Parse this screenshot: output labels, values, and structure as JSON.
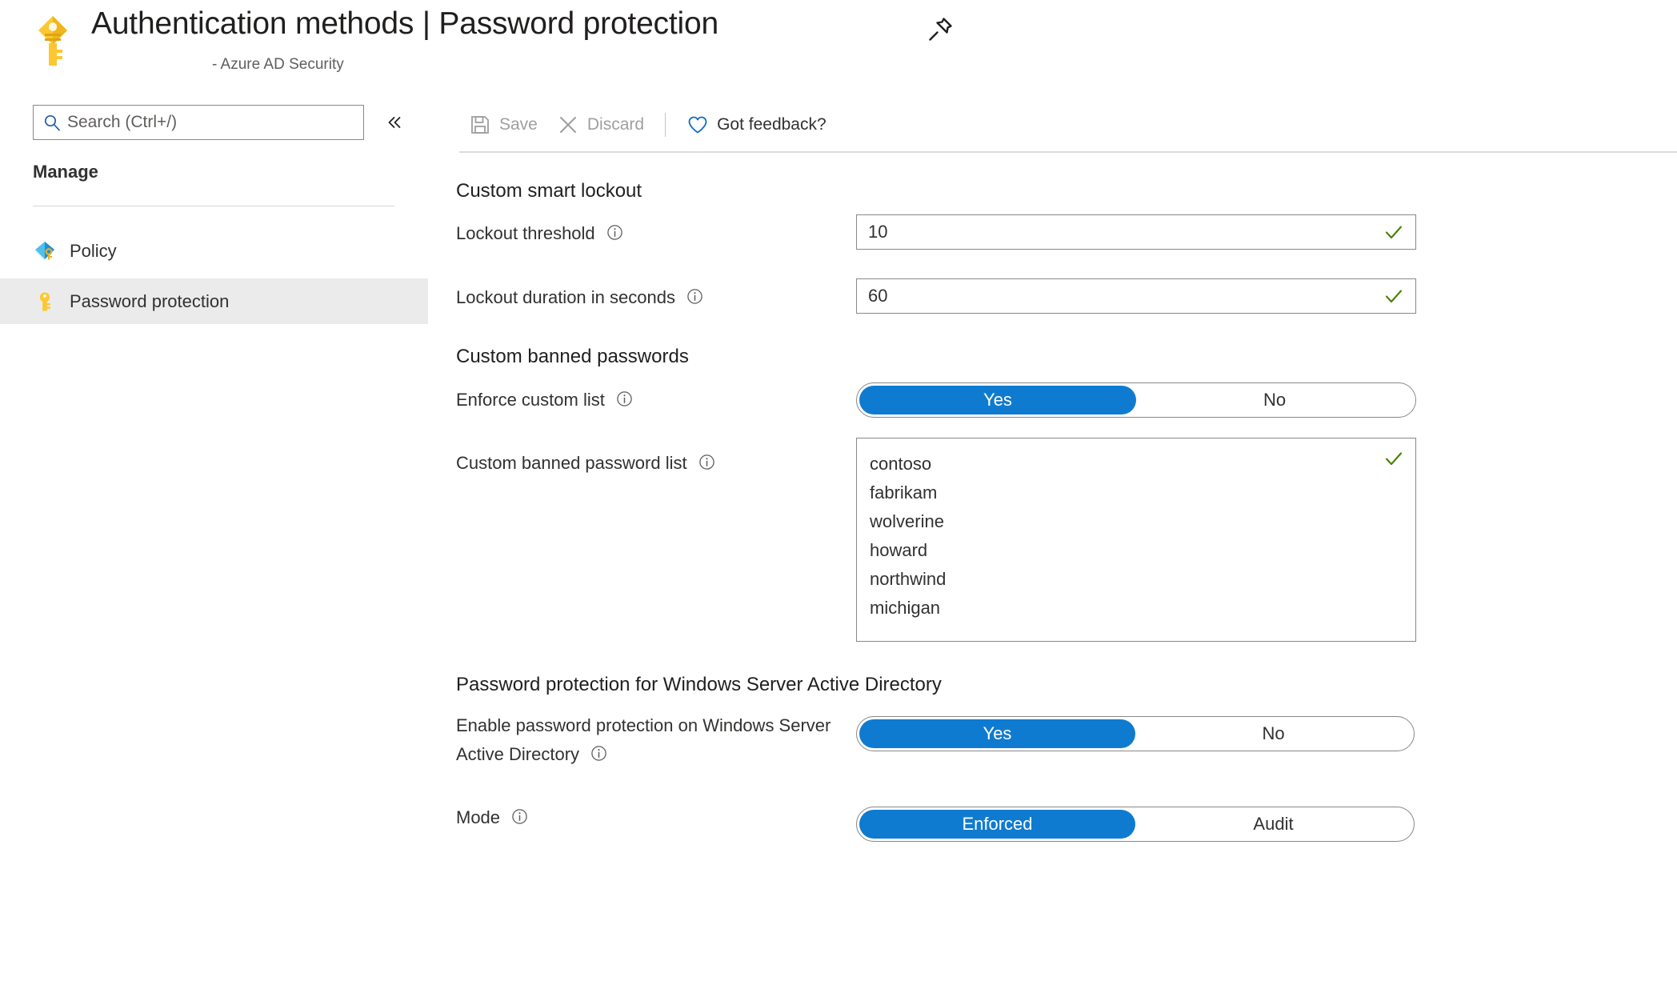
{
  "header": {
    "icon": "key-icon",
    "title": "Authentication methods | Password protection",
    "subtitle": "- Azure AD Security",
    "pin_icon": "pin-icon"
  },
  "sidebar": {
    "search": {
      "placeholder": "Search (Ctrl+/)",
      "value": "",
      "icon": "search-icon"
    },
    "collapse_icon": "chevron-double-left-icon",
    "group_label": "Manage",
    "items": [
      {
        "label": "Policy",
        "icon": "policy-shield-key-icon",
        "selected": false
      },
      {
        "label": "Password protection",
        "icon": "key-icon",
        "selected": true
      }
    ]
  },
  "toolbar": {
    "save_label": "Save",
    "save_icon": "save-floppy-icon",
    "save_disabled": true,
    "discard_label": "Discard",
    "discard_icon": "close-x-icon",
    "discard_disabled": true,
    "feedback_label": "Got feedback?",
    "feedback_icon": "heart-icon"
  },
  "main": {
    "smart_lockout": {
      "section_title": "Custom smart lockout",
      "threshold": {
        "label": "Lockout threshold",
        "info_icon": "info-icon",
        "value": "10",
        "valid_icon": "checkmark-icon"
      },
      "duration": {
        "label": "Lockout duration in seconds",
        "info_icon": "info-icon",
        "value": "60",
        "valid_icon": "checkmark-icon"
      }
    },
    "banned_passwords": {
      "section_title": "Custom banned passwords",
      "enforce": {
        "label": "Enforce custom list",
        "info_icon": "info-icon",
        "options": [
          "Yes",
          "No"
        ],
        "selected": "Yes"
      },
      "list": {
        "label": "Custom banned password list",
        "info_icon": "info-icon",
        "entries": [
          "contoso",
          "fabrikam",
          "wolverine",
          "howard",
          "northwind",
          "michigan"
        ],
        "valid_icon": "checkmark-icon"
      }
    },
    "windows_server_ad": {
      "section_title": "Password protection for Windows Server Active Directory",
      "enable": {
        "label": "Enable password protection on Windows Server Active Directory",
        "info_icon": "info-icon",
        "options": [
          "Yes",
          "No"
        ],
        "selected": "Yes"
      },
      "mode": {
        "label": "Mode",
        "info_icon": "info-icon",
        "options": [
          "Enforced",
          "Audit"
        ],
        "selected": "Enforced"
      }
    }
  },
  "colors": {
    "accent_blue": "#0f7bd0",
    "valid_green": "#498205",
    "key_gold": "#ffc20e",
    "selected_row": "#ebebeb",
    "disabled_text": "#a19f9d"
  }
}
